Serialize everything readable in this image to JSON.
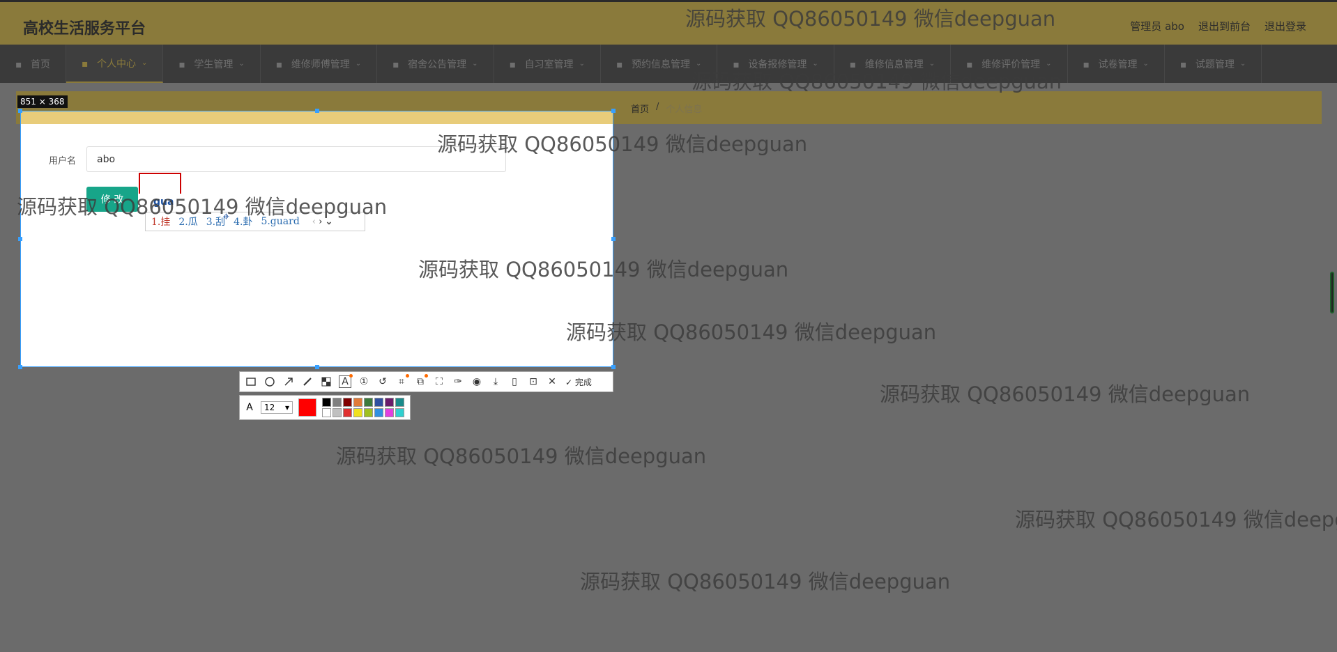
{
  "header": {
    "brand": "高校生活服务平台",
    "user": "管理员 abo",
    "to_front": "退出到前台",
    "logout": "退出登录"
  },
  "nav": [
    {
      "label": "首页",
      "icon": "home-icon",
      "caret": ""
    },
    {
      "label": "个人中心",
      "icon": "user-icon",
      "caret": "⌄"
    },
    {
      "label": "学生管理",
      "icon": "edit-icon",
      "caret": "⌄"
    },
    {
      "label": "维修师傅管理",
      "icon": "list-icon",
      "caret": "⌄"
    },
    {
      "label": "宿舍公告管理",
      "icon": "list-icon",
      "caret": "⌄"
    },
    {
      "label": "自习室管理",
      "icon": "compass-icon",
      "caret": "⌄"
    },
    {
      "label": "预约信息管理",
      "icon": "grid-icon",
      "caret": "⌄"
    },
    {
      "label": "设备报修管理",
      "icon": "doc-icon",
      "caret": "⌄"
    },
    {
      "label": "维修信息管理",
      "icon": "phone-icon",
      "caret": "⌄"
    },
    {
      "label": "维修评价管理",
      "icon": "monitor-icon",
      "caret": "⌄"
    },
    {
      "label": "试卷管理",
      "icon": "doc-icon",
      "caret": "⌄"
    },
    {
      "label": "试题管理",
      "icon": "mic-icon",
      "caret": "⌄"
    }
  ],
  "breadcrumb": {
    "home": "首页",
    "sep": "/",
    "current": "个人信息"
  },
  "capture": {
    "size": "851 × 368"
  },
  "form": {
    "username_label": "用户名",
    "username_value": "abo",
    "save_label": "修 改"
  },
  "ime": {
    "composition": "gua",
    "candidates": [
      "1.挂",
      "2.瓜",
      "3.刮",
      "4.卦",
      "5.guard"
    ],
    "prev": "‹",
    "next": "›",
    "expand": "⌄"
  },
  "toolbar": {
    "tools": [
      "rectangle-icon",
      "ellipse-icon",
      "arrow-icon",
      "pencil-icon",
      "mosaic-icon",
      "text-icon",
      "number-icon",
      "undo-icon",
      "ocr-icon",
      "translate-icon",
      "scan-icon",
      "pin-icon",
      "record-icon",
      "save-icon",
      "phone-icon",
      "bookmark-icon",
      "close-icon"
    ],
    "done_label": "完成"
  },
  "text_options": {
    "font_size": "12",
    "current_color": "#ff0000",
    "palette": [
      "#000000",
      "#808080",
      "#800000",
      "#e07b39",
      "#3c7a3c",
      "#3050a0",
      "#6a1b6a",
      "#1a8a8a",
      "#ffffff",
      "#c0c0c0",
      "#e03030",
      "#f0e020",
      "#a0c020",
      "#3090e0",
      "#e040e0",
      "#30d0d0"
    ]
  },
  "watermark": "源码获取 QQ86050149 微信deepguan"
}
